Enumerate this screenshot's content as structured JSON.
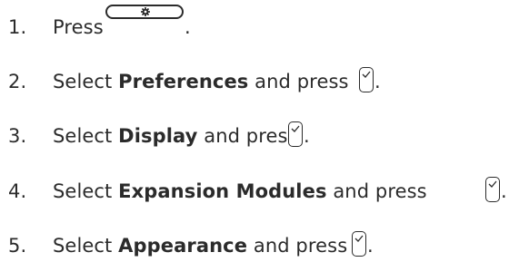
{
  "steps": [
    {
      "number": "1.",
      "before": "Press",
      "bold": "",
      "after": "",
      "key_icon": "settings-gear-key-icon",
      "end": "."
    },
    {
      "number": "2.",
      "before": "Select ",
      "bold": "Preferences",
      "after": " and press",
      "key_icon": "checkmark-select-key-icon",
      "end": "."
    },
    {
      "number": "3.",
      "before": "Select ",
      "bold": "Display",
      "after": " and press",
      "key_icon": "checkmark-select-key-icon",
      "end": "."
    },
    {
      "number": "4.",
      "before": "Select ",
      "bold": "Expansion Modules",
      "after": " and press",
      "key_icon": "checkmark-select-key-icon",
      "end": "."
    },
    {
      "number": "5.",
      "before": "Select ",
      "bold": "Appearance",
      "after": " and press",
      "key_icon": "checkmark-select-key-icon",
      "end": "."
    }
  ]
}
